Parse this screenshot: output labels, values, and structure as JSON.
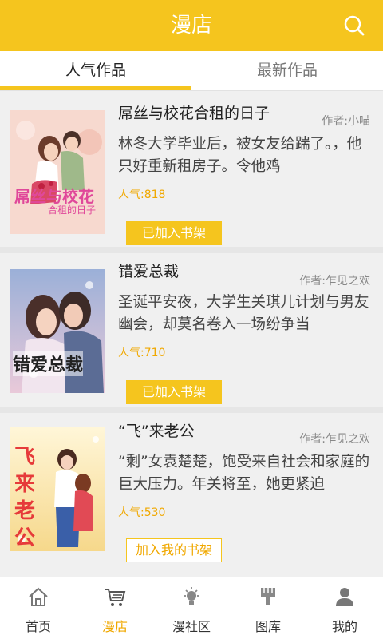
{
  "header": {
    "title": "漫店",
    "search_icon": "search-icon"
  },
  "tabs": [
    {
      "label": "人气作品",
      "active": true
    },
    {
      "label": "最新作品",
      "active": false
    }
  ],
  "books": [
    {
      "title": "屌丝与校花合租的日子",
      "author": "作者:小喵",
      "desc": "林冬大学毕业后，被女友给踹了。，他只好重新租房子。令他鸡",
      "popularity": "人气:818",
      "shelf_label": "已加入书架",
      "cover_text_1": "屌丝与校花",
      "cover_text_2": "合租的日子"
    },
    {
      "title": "错爱总裁",
      "author": "作者:乍见之欢",
      "desc": "圣诞平安夜，大学生关琪儿计划与男友幽会，却莫名卷入一场纷争当",
      "popularity": "人气:710",
      "shelf_label": "已加入书架",
      "cover_text_1": "错爱总裁"
    },
    {
      "title": "“飞”来老公",
      "author": "作者:乍见之欢",
      "desc": "“剩”女袁楚楚，饱受来自社会和家庭的巨大压力。年关将至，她更紧迫",
      "popularity": "人气:530",
      "shelf_label": "加入我的书架",
      "cover_text_1": "飞",
      "cover_text_2": "来",
      "cover_text_3": "老",
      "cover_text_4": "公"
    }
  ],
  "bottom_nav": [
    {
      "label": "首页",
      "icon": "home-icon",
      "active": false
    },
    {
      "label": "漫店",
      "icon": "cart-icon",
      "active": true
    },
    {
      "label": "漫社区",
      "icon": "bulb-icon",
      "active": false
    },
    {
      "label": "图库",
      "icon": "brush-icon",
      "active": false
    },
    {
      "label": "我的",
      "icon": "user-icon",
      "active": false
    }
  ],
  "colors": {
    "accent": "#f5c51e",
    "popularity": "#f0a800"
  }
}
